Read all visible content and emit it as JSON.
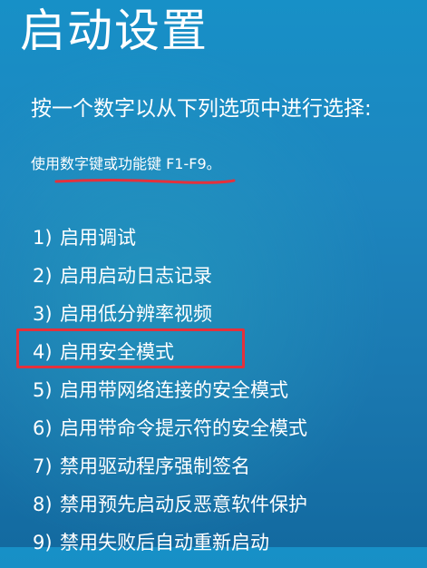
{
  "page": {
    "title": "启动设置",
    "instruction": "按一个数字以从下列选项中进行选择:",
    "hint": "使用数字键或功能键 F1-F9。"
  },
  "options": [
    {
      "num": "1)",
      "label": "启用调试"
    },
    {
      "num": "2)",
      "label": "启用启动日志记录"
    },
    {
      "num": "3)",
      "label": "启用低分辨率视频"
    },
    {
      "num": "4)",
      "label": "启用安全模式"
    },
    {
      "num": "5)",
      "label": "启用带网络连接的安全模式"
    },
    {
      "num": "6)",
      "label": "启用带命令提示符的安全模式"
    },
    {
      "num": "7)",
      "label": "禁用驱动程序强制签名"
    },
    {
      "num": "8)",
      "label": "禁用预先启动反恶意软件保护"
    },
    {
      "num": "9)",
      "label": "禁用失败后自动重新启动"
    }
  ],
  "annotations": {
    "color": "#e4313c",
    "highlighted_option": "4)"
  }
}
